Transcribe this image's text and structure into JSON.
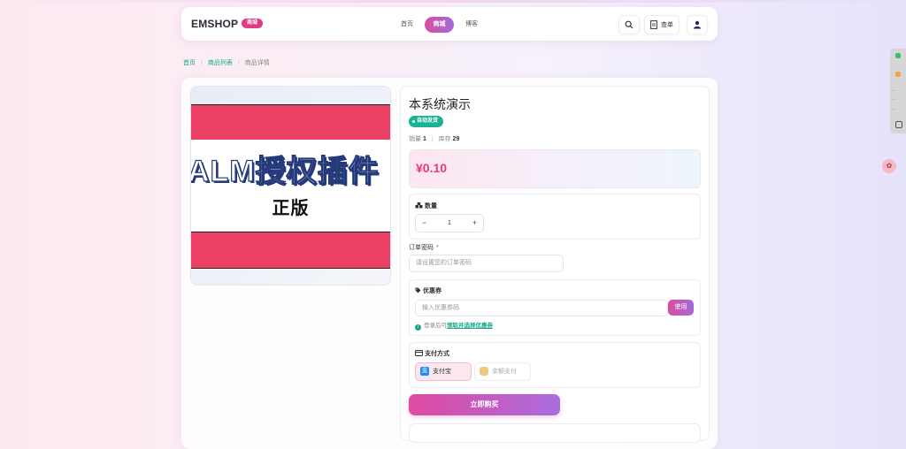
{
  "header": {
    "brand": "EMSHOP",
    "brand_badge": "商城",
    "nav": {
      "home": "首页",
      "shop": "商城",
      "blog": "博客"
    },
    "order_label": "查单"
  },
  "breadcrumb": {
    "home": "首页",
    "list": "商品列表",
    "current": "商品详情"
  },
  "product": {
    "title": "本系统演示",
    "badge": "自动发货",
    "sales_label": "销量",
    "sales_value": "1",
    "stock_label": "库存",
    "stock_value": "29",
    "price": "¥0.10",
    "image_text_main": "ALM授权插件",
    "image_text_sub": "正版"
  },
  "quantity": {
    "label": "数量",
    "minus": "−",
    "value": "1",
    "plus": "+"
  },
  "order_password": {
    "label": "订单密码",
    "required_mark": "*",
    "placeholder": "请设置您的订单密码"
  },
  "coupon": {
    "label": "优惠券",
    "placeholder": "输入优惠券码",
    "use_button": "使用",
    "tip_prefix": "登录后可",
    "tip_link": "领取并选择优惠券"
  },
  "payment": {
    "label": "支付方式",
    "alipay": "支付宝",
    "balance": "余额支付"
  },
  "buy_button": "立即购买",
  "colors": {
    "accent_pink": "#e23a7c",
    "accent_purple": "#a56ad9",
    "green": "#17a689"
  },
  "icons": {
    "search": "search-icon",
    "order": "document-icon",
    "user": "user-icon",
    "quantity": "boxes-icon",
    "coupon": "tag-icon",
    "payment": "card-icon",
    "info": "info-icon"
  }
}
